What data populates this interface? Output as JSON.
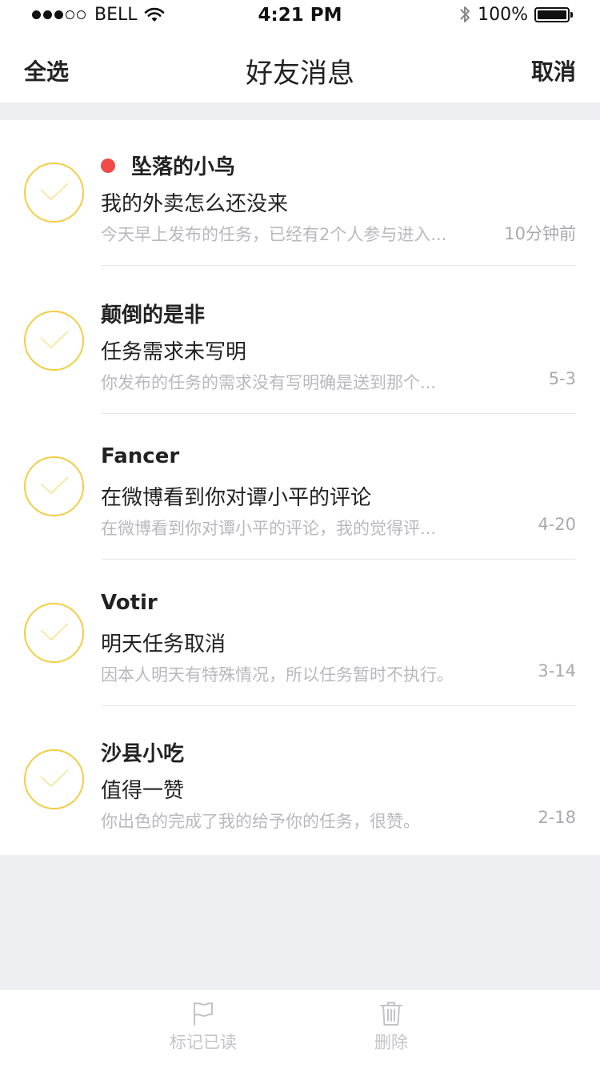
{
  "status_bar": {
    "carrier": "BELL",
    "time": "4:21 PM",
    "battery": "100%",
    "icons": [
      "signal-dots",
      "wifi-icon",
      "bluetooth-icon",
      "battery-icon"
    ]
  },
  "nav": {
    "select_all": "全选",
    "title": "好友消息",
    "cancel": "取消"
  },
  "messages": [
    {
      "name": "坠落的小鸟",
      "unread": true,
      "subject": "我的外卖怎么还没来",
      "preview": "今天早上发布的任务，已经有2个人参与进入...",
      "time": "10分钟前"
    },
    {
      "name": "颠倒的是非",
      "unread": false,
      "subject": "任务需求未写明",
      "preview": "你发布的任务的需求没有写明确是送到那个...",
      "time": "5-3"
    },
    {
      "name": "Fancer",
      "unread": false,
      "subject": "在微博看到你对谭小平的评论",
      "preview": "在微博看到你对谭小平的评论，我的觉得评...",
      "time": "4-20"
    },
    {
      "name": "Votir",
      "unread": false,
      "subject": "明天任务取消",
      "preview": "因本人明天有特殊情况，所以任务暂时不执行。",
      "time": "3-14"
    },
    {
      "name": "沙县小吃",
      "unread": false,
      "subject": "值得一赞",
      "preview": "你出色的完成了我的给予你的任务，很赞。",
      "time": "2-18"
    }
  ],
  "toolbar": {
    "mark_read": "标记已读",
    "delete": "删除"
  },
  "colors": {
    "accent_check": "#f3cd45",
    "unread_dot": "#f24a47",
    "background": "#eeeff3"
  }
}
